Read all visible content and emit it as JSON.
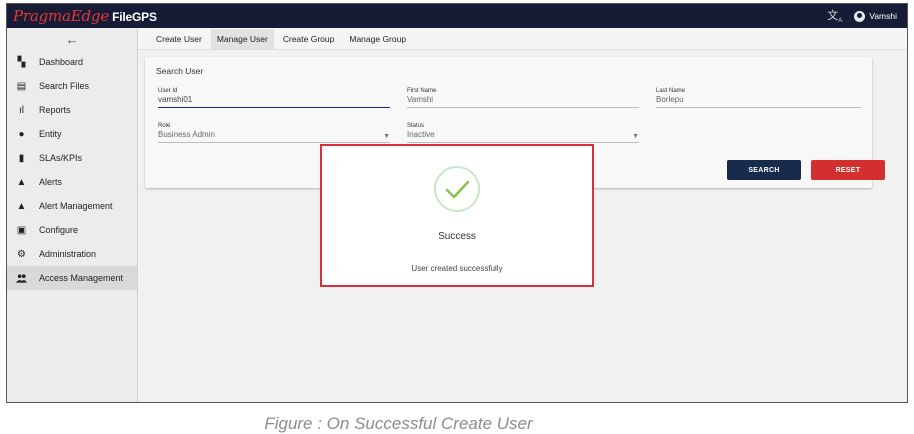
{
  "app": {
    "brand_part1": "PragmaEdge",
    "brand_part2": " FileGPS",
    "username": "Vamshi",
    "translate_icon": "translate-icon",
    "user_icon": "account-circle-icon"
  },
  "sidebar": {
    "back_icon": "←",
    "items": [
      {
        "label": "Dashboard",
        "icon": "▚"
      },
      {
        "label": "Search Files",
        "icon": "▤"
      },
      {
        "label": "Reports",
        "icon": "ıl"
      },
      {
        "label": "Entity",
        "icon": "●"
      },
      {
        "label": "SLAs/KPIs",
        "icon": "▮"
      },
      {
        "label": "Alerts",
        "icon": "▲"
      },
      {
        "label": "Alert Management",
        "icon": "▲"
      },
      {
        "label": "Configure",
        "icon": "▣"
      },
      {
        "label": "Administration",
        "icon": "⚙"
      },
      {
        "label": "Access Management",
        "icon": "👥",
        "active": true
      }
    ]
  },
  "tabs": [
    {
      "label": "Create User",
      "active": false
    },
    {
      "label": "Manage User",
      "active": true
    },
    {
      "label": "Create Group",
      "active": false
    },
    {
      "label": "Manage Group",
      "active": false
    }
  ],
  "search_card": {
    "title": "Search User",
    "fields": {
      "user_id": {
        "label": "User Id",
        "value": "vamshi01"
      },
      "first_name": {
        "label": "First Name",
        "value": "Vamshi"
      },
      "last_name": {
        "label": "Last Name",
        "value": "Borlepu"
      },
      "role": {
        "label": "Role",
        "value": "Business Admin"
      },
      "status": {
        "label": "Status",
        "value": "Inactive"
      }
    },
    "search_button": "SEARCH",
    "reset_button": "RESET"
  },
  "modal": {
    "title": "Success",
    "message": "User created successfully",
    "icon": "check-circle-icon"
  },
  "caption": "Figure : On Successful Create User",
  "colors": {
    "topbar": "#161c36",
    "brand_accent": "#e53935",
    "search_button": "#172b4d",
    "reset_button": "#d32f2f",
    "modal_border": "#d9303a",
    "success_check": "#8bc34a"
  }
}
